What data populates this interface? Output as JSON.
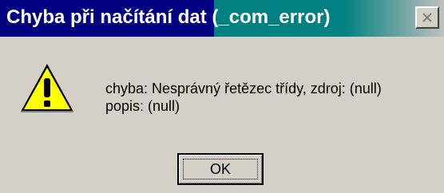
{
  "window": {
    "title": "Chyba při načítání dat (_com_error)",
    "close_icon": "close-icon",
    "colors": {
      "title_bg": "#000080",
      "title_bg_secondary": "#008080",
      "face": "#d4d0c8"
    }
  },
  "dialog": {
    "icon": "warning-icon",
    "message_line1": "chyba: Nesprávný řetězec třídy, zdroj: (null)",
    "message_line2": "popis: (null)",
    "ok_label": "OK"
  }
}
